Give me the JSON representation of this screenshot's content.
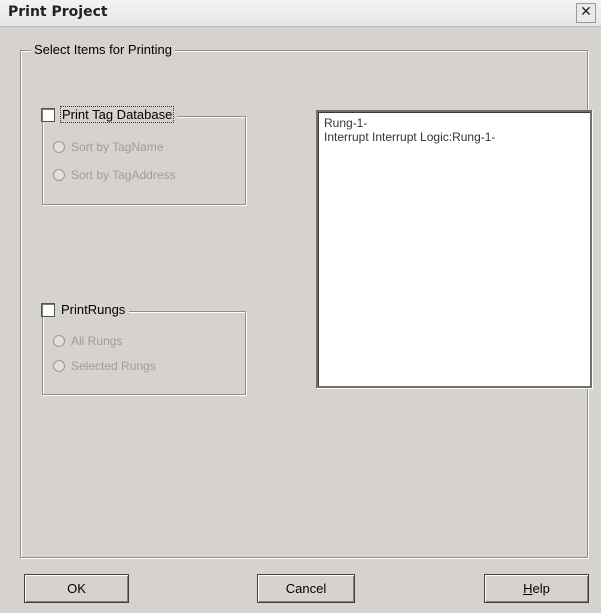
{
  "window": {
    "title": "Print Project",
    "close_glyph": "✕"
  },
  "main_group": {
    "label": "Select Items for Printing"
  },
  "tag_database": {
    "checkbox_label": "Print Tag Database",
    "checked": false,
    "options": [
      {
        "label": "Sort by TagName",
        "enabled": false
      },
      {
        "label": "Sort by TagAddress",
        "enabled": false
      }
    ]
  },
  "print_rungs": {
    "checkbox_label": "PrintRungs",
    "checked": false,
    "options": [
      {
        "label": "All Rungs",
        "enabled": false
      },
      {
        "label": "Selected Rungs",
        "enabled": false
      }
    ]
  },
  "rung_list": {
    "items": [
      "Rung-1-",
      "Interrupt Interrupt Logic:Rung-1-"
    ]
  },
  "buttons": {
    "ok": "OK",
    "cancel": "Cancel",
    "help_first": "H",
    "help_rest": "elp"
  },
  "icons": {
    "close": "close-icon",
    "checkbox": "checkbox-icon",
    "radio": "radio-icon"
  }
}
